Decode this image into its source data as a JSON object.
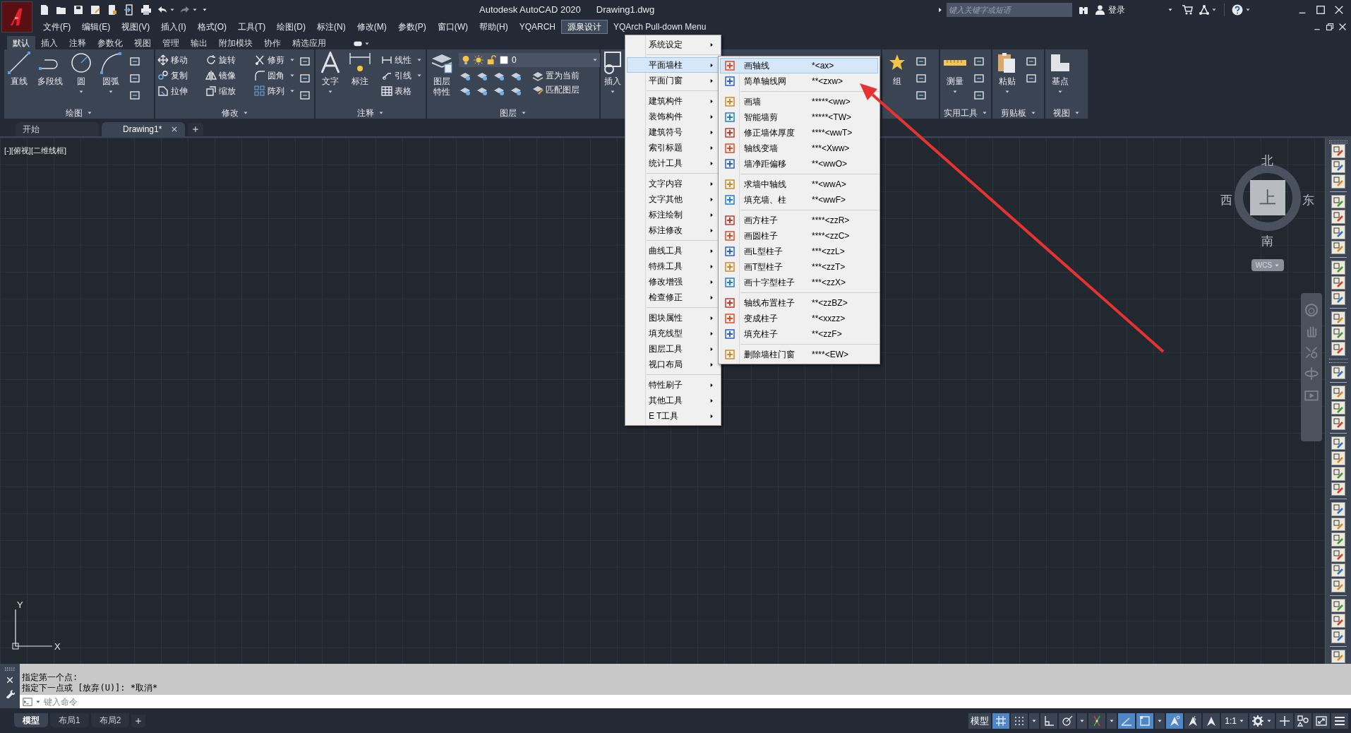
{
  "title_bar": {
    "app_title": "Autodesk AutoCAD 2020",
    "file_name": "Drawing1.dwg",
    "search_placeholder": "键入关键字或短语",
    "sign_in": "登录"
  },
  "menu_bar": [
    {
      "label": "文件(F)",
      "selected": false
    },
    {
      "label": "编辑(E)",
      "selected": false
    },
    {
      "label": "视图(V)",
      "selected": false
    },
    {
      "label": "插入(I)",
      "selected": false
    },
    {
      "label": "格式(O)",
      "selected": false
    },
    {
      "label": "工具(T)",
      "selected": false
    },
    {
      "label": "绘图(D)",
      "selected": false
    },
    {
      "label": "标注(N)",
      "selected": false
    },
    {
      "label": "修改(M)",
      "selected": false
    },
    {
      "label": "参数(P)",
      "selected": false
    },
    {
      "label": "窗口(W)",
      "selected": false
    },
    {
      "label": "帮助(H)",
      "selected": false
    },
    {
      "label": "YQARCH",
      "selected": false
    },
    {
      "label": "源泉设计",
      "selected": true
    },
    {
      "label": "YQArch Pull-down Menu",
      "selected": false
    }
  ],
  "ribbon_tabs": [
    {
      "label": "默认",
      "selected": true
    },
    {
      "label": "插入",
      "selected": false
    },
    {
      "label": "注释",
      "selected": false
    },
    {
      "label": "参数化",
      "selected": false
    },
    {
      "label": "视图",
      "selected": false
    },
    {
      "label": "管理",
      "selected": false
    },
    {
      "label": "输出",
      "selected": false
    },
    {
      "label": "附加模块",
      "selected": false
    },
    {
      "label": "协作",
      "selected": false
    },
    {
      "label": "精选应用",
      "selected": false
    }
  ],
  "ribbon_panels": [
    {
      "title": "绘图",
      "large": [
        {
          "label": "直线",
          "dropdown": false
        },
        {
          "label": "多段线",
          "dropdown": false
        },
        {
          "label": "圆",
          "dropdown": true
        },
        {
          "label": "圆弧",
          "dropdown": true
        }
      ]
    },
    {
      "title": "修改",
      "small": [
        {
          "label": "移动",
          "dropdown": false
        },
        {
          "label": "旋转",
          "dropdown": false
        },
        {
          "label": "修剪",
          "dropdown": true
        },
        {
          "label": "复制",
          "dropdown": false
        },
        {
          "label": "镜像",
          "dropdown": false
        },
        {
          "label": "圆角",
          "dropdown": true
        },
        {
          "label": "拉伸",
          "dropdown": false
        },
        {
          "label": "缩放",
          "dropdown": false
        },
        {
          "label": "阵列",
          "dropdown": true
        }
      ]
    },
    {
      "title": "注释",
      "large": [
        {
          "label": "文字",
          "dropdown": true
        },
        {
          "label": "标注",
          "dropdown": false
        }
      ],
      "small": [
        {
          "label": "线性",
          "dropdown": true
        },
        {
          "label": "引线",
          "dropdown": true
        },
        {
          "label": "表格",
          "dropdown": false
        }
      ]
    },
    {
      "title": "图层",
      "large": [
        {
          "label": "图层特性",
          "dropdown": false
        }
      ],
      "layer_value": "0",
      "small": [
        {
          "label": "置为当前",
          "dropdown": false
        },
        {
          "label": "匹配图层",
          "dropdown": false
        }
      ]
    },
    {
      "large": [
        {
          "label": "插入",
          "dropdown": true
        }
      ]
    },
    {
      "large": [
        {
          "label": "组",
          "dropdown": false
        }
      ]
    },
    {
      "title": "实用工具",
      "large": [
        {
          "label": "测量",
          "dropdown": true
        }
      ]
    },
    {
      "title": "剪贴板",
      "large": [
        {
          "label": "粘贴",
          "dropdown": true
        }
      ]
    },
    {
      "title": "视图",
      "large": [
        {
          "label": "基点",
          "dropdown": true
        }
      ]
    }
  ],
  "document_tabs": [
    {
      "label": "开始",
      "selected": false
    },
    {
      "label": "Drawing1*",
      "selected": true
    }
  ],
  "viewport_label": "[-][俯视][二维线框]",
  "view_cube": {
    "north": "北",
    "south": "南",
    "west": "西",
    "east": "东",
    "face": "上",
    "ucs": "WCS"
  },
  "ucs_icon": {
    "y": "Y",
    "x": "X"
  },
  "dropdown_menu": [
    [
      {
        "label": "系统设定",
        "selected": false
      }
    ],
    [
      {
        "label": "平面墙柱",
        "selected": true
      },
      {
        "label": "平面门窗",
        "selected": false
      }
    ],
    [
      {
        "label": "建筑构件",
        "selected": false
      },
      {
        "label": "装饰构件",
        "selected": false
      },
      {
        "label": "建筑符号",
        "selected": false
      },
      {
        "label": "索引标题",
        "selected": false
      },
      {
        "label": "统计工具",
        "selected": false
      }
    ],
    [
      {
        "label": "文字内容",
        "selected": false
      },
      {
        "label": "文字其他",
        "selected": false
      },
      {
        "label": "标注绘制",
        "selected": false
      },
      {
        "label": "标注修改",
        "selected": false
      }
    ],
    [
      {
        "label": "曲线工具",
        "selected": false
      },
      {
        "label": "特殊工具",
        "selected": false
      },
      {
        "label": "修改增强",
        "selected": false
      },
      {
        "label": "检查修正",
        "selected": false
      }
    ],
    [
      {
        "label": "图块属性",
        "selected": false
      },
      {
        "label": "填充线型",
        "selected": false
      },
      {
        "label": "图层工具",
        "selected": false
      },
      {
        "label": "视口布局",
        "selected": false
      }
    ],
    [
      {
        "label": "特性刷子",
        "selected": false
      },
      {
        "label": "其他工具",
        "selected": false
      },
      {
        "label": "E T工具",
        "selected": false
      }
    ]
  ],
  "submenu": [
    [
      {
        "label": "画轴线",
        "shortcut": "*<ax>",
        "selected": true
      },
      {
        "label": "简单轴线网",
        "shortcut": "**<zxw>",
        "selected": false
      }
    ],
    [
      {
        "label": "画墙",
        "shortcut": "*****<ww>",
        "selected": false
      },
      {
        "label": "智能墙剪",
        "shortcut": "*****<TW>",
        "selected": false
      },
      {
        "label": "修正墙体厚度",
        "shortcut": "****<wwT>",
        "selected": false
      },
      {
        "label": "轴线变墙",
        "shortcut": "***<Xww>",
        "selected": false
      },
      {
        "label": "墙净距偏移",
        "shortcut": "**<wwO>",
        "selected": false
      }
    ],
    [
      {
        "label": "求墙中轴线",
        "shortcut": "**<wwA>",
        "selected": false
      },
      {
        "label": "填充墙、柱",
        "shortcut": "**<wwF>",
        "selected": false
      }
    ],
    [
      {
        "label": "画方柱子",
        "shortcut": "****<zzR>",
        "selected": false
      },
      {
        "label": "画圆柱子",
        "shortcut": "****<zzC>",
        "selected": false
      },
      {
        "label": "画L型柱子",
        "shortcut": "***<zzL>",
        "selected": false
      },
      {
        "label": "画T型柱子",
        "shortcut": "***<zzT>",
        "selected": false
      },
      {
        "label": "画十字型柱子",
        "shortcut": "***<zzX>",
        "selected": false
      }
    ],
    [
      {
        "label": "轴线布置柱子",
        "shortcut": "**<zzBZ>",
        "selected": false
      },
      {
        "label": "变成柱子",
        "shortcut": "**<xxzz>",
        "selected": false
      },
      {
        "label": "填充柱子",
        "shortcut": "**<zzF>",
        "selected": false
      }
    ],
    [
      {
        "label": "删除墙柱门窗",
        "shortcut": "****<EW>",
        "selected": false
      }
    ]
  ],
  "command_history": [
    "指定第一个点:",
    "指定下一点或 [放弃(U)]: *取消*"
  ],
  "command_line": {
    "placeholder": "键入命令"
  },
  "layout_tabs": [
    {
      "label": "模型",
      "selected": true
    },
    {
      "label": "布局1",
      "selected": false
    },
    {
      "label": "布局2",
      "selected": false
    }
  ],
  "status_bar": {
    "model": "模型",
    "toggles": [
      {
        "kind": "grid",
        "on": true
      },
      {
        "kind": "snap",
        "on": false
      },
      {
        "kind": "ortho",
        "on": false
      },
      {
        "kind": "polar",
        "on": false
      },
      {
        "kind": "track",
        "on": false
      },
      {
        "kind": "angle",
        "on": true
      },
      {
        "kind": "frame",
        "on": true
      },
      {
        "kind": "annotate",
        "on": true
      },
      {
        "kind": "autoscale",
        "on": false
      },
      {
        "kind": "annovis",
        "on": false
      }
    ],
    "scale": "1:1"
  }
}
